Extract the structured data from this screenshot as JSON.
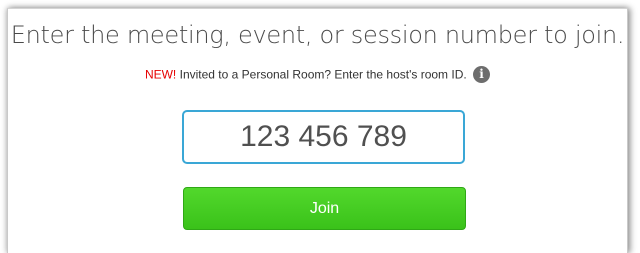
{
  "heading": "Enter the meeting, event, or session number to join.",
  "notice": {
    "new_label": "NEW!",
    "text": " Invited to a Personal Room? Enter the host's room ID.",
    "info_icon": "info-icon",
    "info_glyph": "i"
  },
  "meeting_number": {
    "value": "123 456 789"
  },
  "join_button": {
    "label": "Join"
  },
  "colors": {
    "new_label": "#e60000",
    "input_border": "#3aa7d6",
    "join_button": "#44c922"
  }
}
